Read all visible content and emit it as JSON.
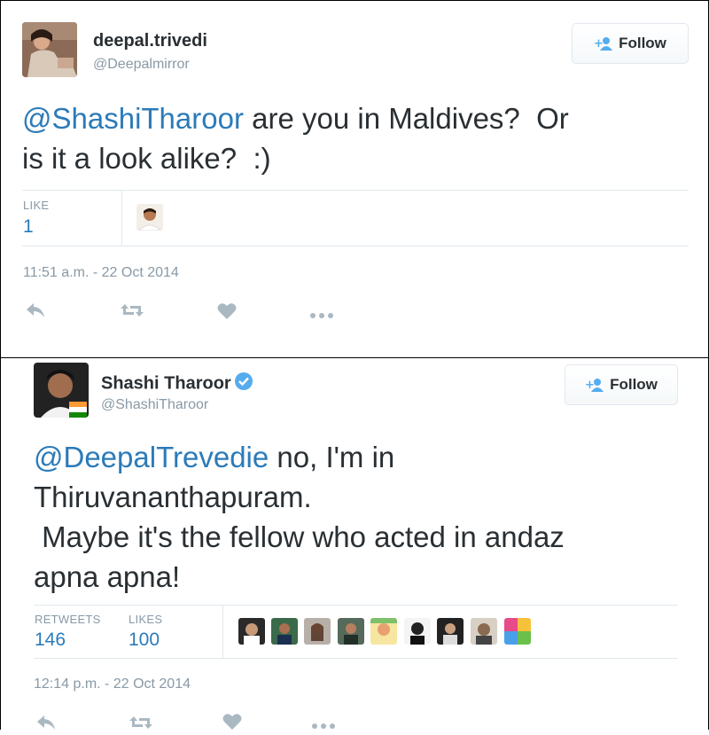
{
  "tweet1": {
    "display_name": "deepal.trivedi",
    "handle": "@Deepalmirror",
    "follow_label": "Follow",
    "text_mention": "@ShashiTharoor",
    "text_rest": " are you in Maldives?  Or\nis it a look alike?  :)",
    "likes_label": "LIKE",
    "likes_count": "1",
    "timestamp": "11:51 a.m. - 22 Oct 2014"
  },
  "tweet2": {
    "display_name": "Shashi Tharoor",
    "verified": true,
    "handle": "@ShashiTharoor",
    "follow_label": "Follow",
    "text_mention": "@DeepalTrevedie",
    "text_rest": " no, I'm in\nThiruvananthapuram.\n Maybe it's the fellow who acted in andaz\napna apna!",
    "retweets_label": "RETWEETS",
    "retweets_count": "146",
    "likes_label": "LIKES",
    "likes_count": "100",
    "timestamp": "12:14 p.m. - 22 Oct 2014"
  },
  "icons": [
    "follow-person-icon",
    "reply-icon",
    "retweet-icon",
    "like-heart-icon",
    "more-icon",
    "verified-badge-icon"
  ],
  "colors": {
    "link": "#2b7bb9",
    "muted": "#8899a6",
    "text": "#292f33",
    "verified": "#55acee",
    "border": "#e1e8ed",
    "icon": "#aab8c2"
  }
}
